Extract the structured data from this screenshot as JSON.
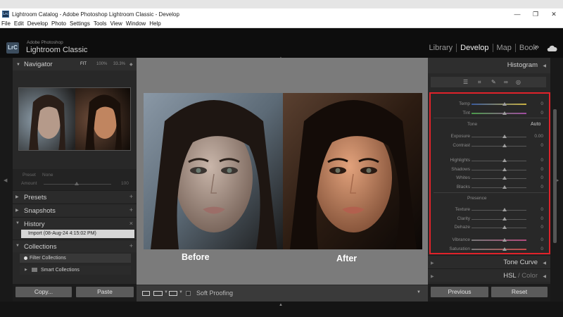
{
  "window": {
    "title": "Lightroom Catalog - Adobe Photoshop Lightroom Classic - Develop",
    "app_icon_text": "Lrc",
    "controls": [
      "—",
      "❐",
      "✕"
    ]
  },
  "menu": [
    "File",
    "Edit",
    "Develop",
    "Photo",
    "Settings",
    "Tools",
    "View",
    "Window",
    "Help"
  ],
  "identity": {
    "badge": "LrC",
    "line1": "Adobe Photoshop",
    "line2": "Lightroom Classic"
  },
  "modules": [
    "Library",
    "Develop",
    "Map",
    "Book"
  ],
  "module_more": "»",
  "left": {
    "navigator": {
      "title": "Navigator",
      "fit": "FIT",
      "z100": "100%",
      "z333": "33.3%"
    },
    "preset": {
      "label": "Preset",
      "value": "None",
      "amount_label": "Amount",
      "amount_value": "100",
      "amount_fraction": 0.5
    },
    "sections": {
      "presets": "Presets",
      "snapshots": "Snapshots",
      "history": "History",
      "collections": "Collections"
    },
    "history_item": "Import (08-Aug-24 4:15:02 PM)",
    "collections": {
      "filter": "Filter Collections",
      "smart": "Smart Collections"
    },
    "copy_btn": "Copy...",
    "paste_btn": "Paste"
  },
  "center": {
    "label_before": "Before",
    "label_after": "After",
    "soft_proofing": "Soft Proofing"
  },
  "right": {
    "histogram": "Histogram",
    "tool_glyphs": [
      "☰",
      "⌗",
      "✎",
      "∞",
      "◎"
    ],
    "wb": [
      {
        "label": "Temp",
        "value": "0",
        "pos": 0.6
      },
      {
        "label": "Tint",
        "value": "0",
        "pos": 0.6
      }
    ],
    "tone_label": "Tone",
    "auto_label": "Auto",
    "tone": [
      {
        "label": "Exposure",
        "value": "0.00",
        "pos": 0.6
      },
      {
        "label": "Contrast",
        "value": "0",
        "pos": 0.6
      }
    ],
    "tone2": [
      {
        "label": "Highlights",
        "value": "0",
        "pos": 0.6
      },
      {
        "label": "Shadows",
        "value": "0",
        "pos": 0.6
      },
      {
        "label": "Whites",
        "value": "0",
        "pos": 0.6
      },
      {
        "label": "Blacks",
        "value": "0",
        "pos": 0.6
      }
    ],
    "presence_label": "Presence",
    "presence": [
      {
        "label": "Texture",
        "value": "0",
        "pos": 0.6
      },
      {
        "label": "Clarity",
        "value": "0",
        "pos": 0.6
      },
      {
        "label": "Dehaze",
        "value": "0",
        "pos": 0.6
      }
    ],
    "presence2": [
      {
        "label": "Vibrance",
        "value": "0",
        "pos": 0.6
      },
      {
        "label": "Saturation",
        "value": "0",
        "pos": 0.6
      }
    ],
    "tone_curve": "Tone Curve",
    "hsl": "HSL",
    "hsl_sep": " / ",
    "color": "Color",
    "previous_btn": "Previous",
    "reset_btn": "Reset"
  },
  "colors": {
    "highlight_box": "#e0222a",
    "panel": "#282828",
    "center": "#7b7b7b"
  }
}
